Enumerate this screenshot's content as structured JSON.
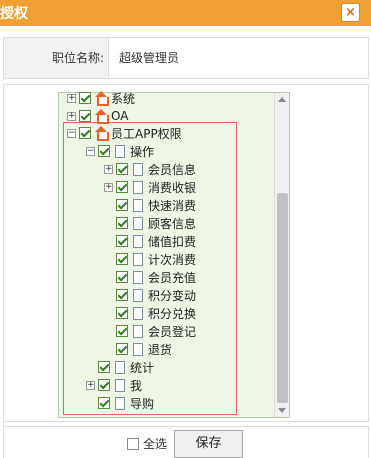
{
  "dialog": {
    "title": "授权",
    "close_label": "×"
  },
  "form": {
    "position_label": "职位名称:",
    "position_value": "超级管理员"
  },
  "tree": {
    "nodes": [
      {
        "label": "系统",
        "expander": "+",
        "icon": "house"
      },
      {
        "label": "OA",
        "expander": "+",
        "icon": "house"
      },
      {
        "label": "员工APP权限",
        "expander": "−",
        "icon": "house"
      },
      {
        "label": "操作",
        "expander": "−",
        "icon": "page"
      },
      {
        "label": "会员信息",
        "expander": "+",
        "icon": "page"
      },
      {
        "label": "消费收银",
        "expander": "+",
        "icon": "page"
      },
      {
        "label": "快速消费",
        "expander": "",
        "icon": "page"
      },
      {
        "label": "顾客信息",
        "expander": "",
        "icon": "page"
      },
      {
        "label": "储值扣费",
        "expander": "",
        "icon": "page"
      },
      {
        "label": "计次消费",
        "expander": "",
        "icon": "page"
      },
      {
        "label": "会员充值",
        "expander": "",
        "icon": "page"
      },
      {
        "label": "积分变动",
        "expander": "",
        "icon": "page"
      },
      {
        "label": "积分兑换",
        "expander": "",
        "icon": "page"
      },
      {
        "label": "会员登记",
        "expander": "",
        "icon": "page"
      },
      {
        "label": "退货",
        "expander": "",
        "icon": "page"
      },
      {
        "label": "统计",
        "expander": "",
        "icon": "page"
      },
      {
        "label": "我",
        "expander": "+",
        "icon": "page"
      },
      {
        "label": "导购",
        "expander": "",
        "icon": "page"
      }
    ]
  },
  "footer": {
    "select_all_label": "全选",
    "save_label": "保存"
  },
  "colors": {
    "titlebar": "#f0a030",
    "tree_bg": "#eef6e6",
    "highlight_border": "#d66666"
  }
}
